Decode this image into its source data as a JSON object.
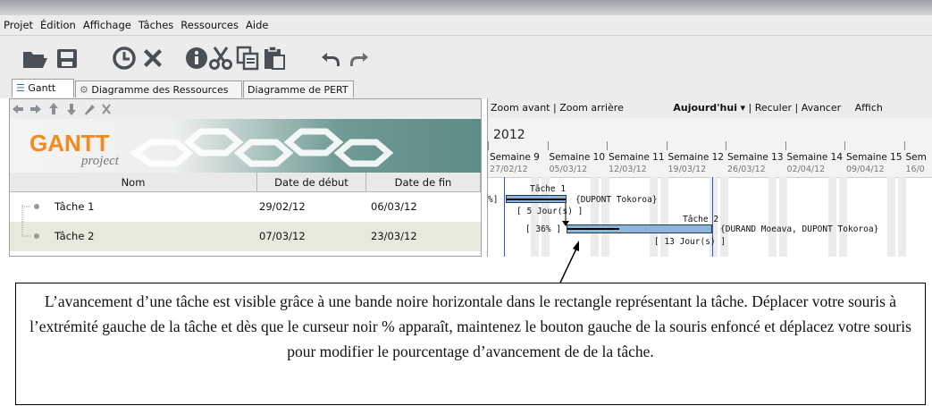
{
  "menu": [
    "Projet",
    "Édition",
    "Affichage",
    "Tâches",
    "Ressources",
    "Aide"
  ],
  "toolbar_icons": [
    "open-folder-icon",
    "save-icon",
    "clock-icon",
    "delete-icon",
    "info-icon",
    "cut-icon",
    "copy-icon",
    "paste-icon",
    "undo-icon",
    "redo-icon"
  ],
  "tabs": [
    "Gantt",
    "Diagramme des Ressources",
    "Diagramme de PERT"
  ],
  "logo": {
    "main": "GANTT",
    "sub": "project"
  },
  "table": {
    "columns": [
      "Nom",
      "Date de début",
      "Date de fin"
    ],
    "rows": [
      {
        "name": "Tâche 1",
        "start": "29/02/12",
        "end": "06/03/12"
      },
      {
        "name": "Tâche 2",
        "start": "07/03/12",
        "end": "23/03/12"
      }
    ]
  },
  "gantt_toolbar": {
    "zoom_in": "Zoom avant",
    "zoom_out": "Zoom arrière",
    "today": "Aujourd'hui",
    "back": "Reculer",
    "forward": "Avancer",
    "display": "Affich"
  },
  "year": "2012",
  "weeks": [
    {
      "label": "Semaine 9",
      "date": "27/02/12"
    },
    {
      "label": "Semaine 10",
      "date": "05/03/12"
    },
    {
      "label": "Semaine 11",
      "date": "12/03/12"
    },
    {
      "label": "Semaine 12",
      "date": "19/03/12"
    },
    {
      "label": "Semaine 13",
      "date": "26/03/12"
    },
    {
      "label": "Semaine 14",
      "date": "02/04/12"
    },
    {
      "label": "Semaine 15",
      "date": "09/04/12"
    },
    {
      "label": "Sem",
      "date": "16/0"
    }
  ],
  "gantt_tasks": [
    {
      "name": "Tâche 1",
      "progress_label": "%]",
      "duration": "[ 5 Jour(s) ]",
      "resources": "{DUPONT Tokoroa}"
    },
    {
      "name": "Tâche 2",
      "progress_label": "[ 36% ]",
      "progress": 0.36,
      "duration": "[ 13 Jour(s) ]",
      "resources": "{DURAND Moeava, DUPONT Tokoroa}"
    }
  ],
  "callout_text": "L’avancement d’une tâche est visible grâce à une bande noire horizontale dans le rectangle représentant la tâche. Déplacer votre souris à l’extrémité gauche de la tâche et dès que le curseur noir % apparaît, maintenez le bouton gauche de la souris enfoncé et déplacez votre souris pour modifier le pourcentage d’avancement de  de la tâche."
}
